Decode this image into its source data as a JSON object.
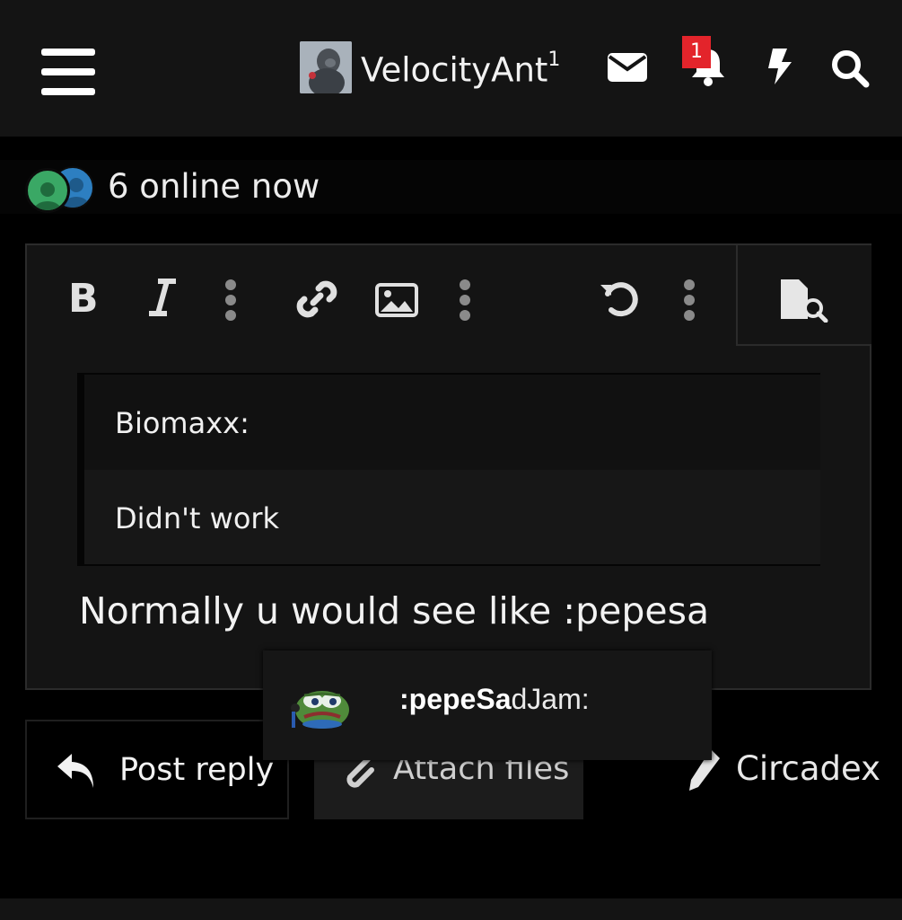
{
  "header": {
    "username": "VelocityAnt",
    "username_suffix": "1",
    "notification_count": "1",
    "icons": [
      "hamburger-menu-icon",
      "envelope-icon",
      "bell-icon",
      "bolt-icon",
      "search-icon"
    ]
  },
  "online": {
    "text": "6 online now"
  },
  "editor": {
    "toolbar": [
      "bold-icon",
      "italic-icon",
      "more-vertical-icon",
      "link-icon",
      "image-icon",
      "more-vertical-icon",
      "undo-icon",
      "more-vertical-icon",
      "preview-icon"
    ],
    "quote": {
      "author": "Biomaxx:",
      "text": "Didn't work"
    },
    "draft": "Normally u would see like :pepesa"
  },
  "autocomplete": {
    "match": ":pepeSa",
    "rest": "dJam:",
    "emoji": "pepe-sad-jam-emoji"
  },
  "actions": {
    "post_reply": "Post reply",
    "attach_files": "Attach files",
    "author": "Circadex"
  },
  "colors": {
    "background": "#000000",
    "panel": "#141414",
    "badge": "#e3242b",
    "text": "#f2f2f2"
  }
}
